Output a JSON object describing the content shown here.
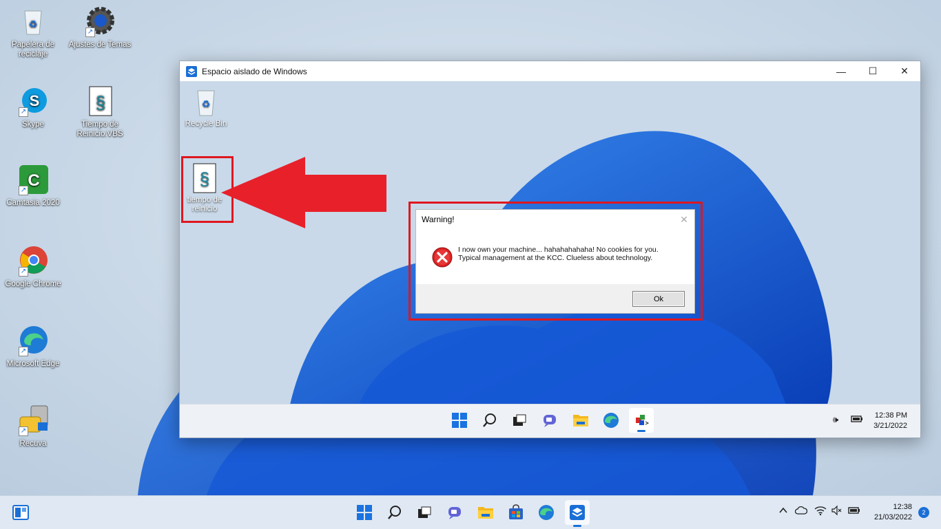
{
  "desktop": {
    "icons": [
      {
        "label": "Papelera de reciclaje"
      },
      {
        "label": "Ajustes de Temas"
      },
      {
        "label": "Skype"
      },
      {
        "label": "Tiempo de Reinicio.VBS"
      },
      {
        "label": "Camtasia 2020"
      },
      {
        "label": "Google Chrome"
      },
      {
        "label": "Microsoft Edge"
      },
      {
        "label": "Recuva"
      }
    ]
  },
  "sandbox": {
    "title": "Espacio aislado de Windows",
    "controls": {
      "minimize": "—",
      "maximize": "☐",
      "close": "✕"
    },
    "icons": [
      {
        "label": "Recycle Bin"
      },
      {
        "label": "tiempo de reinicio"
      }
    ],
    "clock": {
      "time": "12:38 PM",
      "date": "3/21/2022"
    }
  },
  "dialog": {
    "title": "Warning!",
    "close": "✕",
    "message": "I now own your machine... hahahahahaha! No cookies for you. Typical management at the KCC. Clueless about technology.",
    "ok_label": "Ok"
  },
  "taskbar": {
    "clock": {
      "time": "12:38",
      "date": "21/03/2022"
    },
    "notification_count": "2"
  },
  "colors": {
    "highlight": "#e0161e",
    "accent": "#1a6fd6"
  }
}
